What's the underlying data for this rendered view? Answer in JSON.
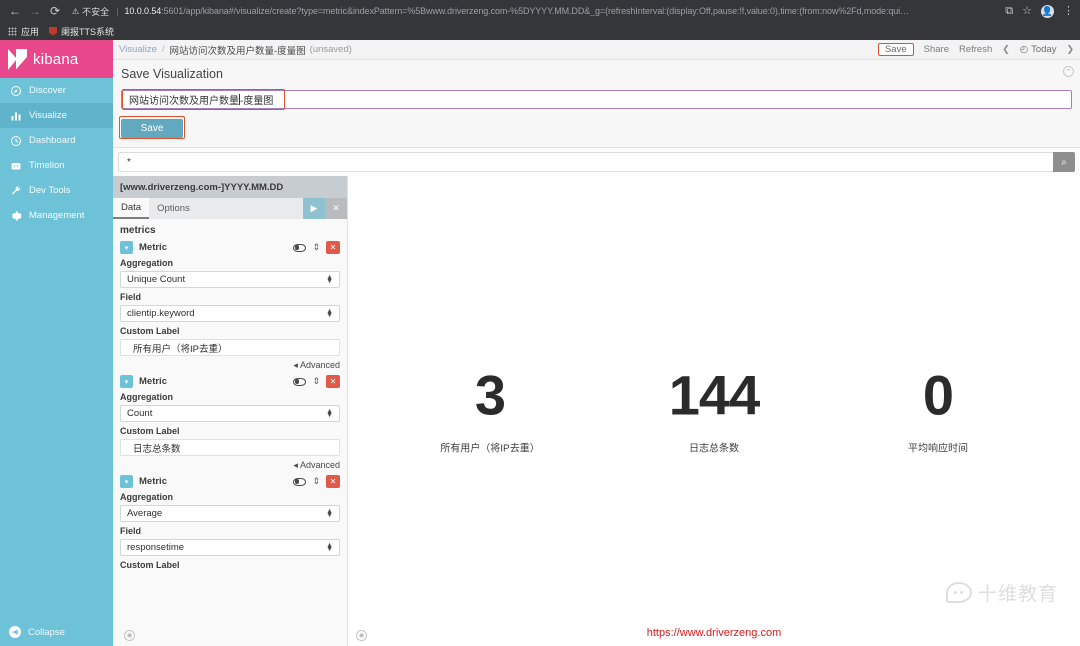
{
  "browser": {
    "back_icon": "←",
    "forward_icon": "→",
    "reload_icon": "⟳",
    "security_label": "不安全",
    "warning_icon": "⚠",
    "url_host": "10.0.0.54",
    "url_rest": ":5601/app/kibana#/visualize/create?type=metric&indexPattern=%5Bwww.driverzeng.com-%5DYYYY.MM.DD&_g=(refreshInterval:(display:Off,pause:!f,value:0),time:(from:now%2Fd,mode:qui…",
    "cast_icon": "⧉",
    "star_icon": "☆",
    "profile_icon": "●",
    "menu_icon": "⋮",
    "bookmarks": [
      {
        "label": "应用",
        "icon": "apps-grid-icon"
      },
      {
        "label": "阑报TTS系统",
        "icon": "bookmark-favicon"
      }
    ]
  },
  "sidebar": {
    "brand": "kibana",
    "items": [
      {
        "label": "Discover",
        "icon": "compass-icon",
        "active": false
      },
      {
        "label": "Visualize",
        "icon": "bar-chart-icon",
        "active": true
      },
      {
        "label": "Dashboard",
        "icon": "dashboard-clock-icon",
        "active": false
      },
      {
        "label": "Timelion",
        "icon": "timelion-icon",
        "active": false
      },
      {
        "label": "Dev Tools",
        "icon": "wrench-icon",
        "active": false
      },
      {
        "label": "Management",
        "icon": "gear-icon",
        "active": false
      }
    ],
    "collapse_label": "Collapse",
    "collapse_icon": "◀"
  },
  "topbar": {
    "breadcrumb_root": "Visualize",
    "breadcrumb_sep": "/",
    "breadcrumb_title": "网站访问次数及用户数量-度量图",
    "unsaved_label": "(unsaved)",
    "save_label": "Save",
    "share_label": "Share",
    "refresh_label": "Refresh",
    "prev_icon": "❮",
    "next_icon": "❯",
    "clock_icon": "◴",
    "time_label": "Today"
  },
  "save_panel": {
    "heading": "Save Visualization",
    "title_value": "网站访问次数及用户数量",
    "title_value_tail": "-度量图",
    "save_button": "Save",
    "collapse_icon": "⌃"
  },
  "query": {
    "value": "*",
    "search_icon": "⌕"
  },
  "editor": {
    "index_pattern": "[www.driverzeng.com-]YYYY.MM.DD",
    "panel_collapse_icon": "❮",
    "tabs": [
      {
        "label": "Data",
        "active": true
      },
      {
        "label": "Options",
        "active": false
      }
    ],
    "apply_icon": "▶",
    "discard_icon": "✕",
    "section_title": "metrics",
    "metric_label": "Metric",
    "toggle_icon": "▾",
    "eye_icon": "eye-icon",
    "grip_icon": "⇕",
    "delete_icon": "✕",
    "aggregation_label": "Aggregation",
    "field_label": "Field",
    "custom_label_label": "Custom Label",
    "advanced_label": "Advanced",
    "advanced_caret": "◂",
    "foot_icon": "◉",
    "metrics": [
      {
        "aggregation": "Unique Count",
        "field": "clientip.keyword",
        "custom_label": "所有用户（将IP去重）",
        "has_field": true
      },
      {
        "aggregation": "Count",
        "field": null,
        "custom_label": "日志总条数",
        "has_field": false
      },
      {
        "aggregation": "Average",
        "field": "responsetime",
        "custom_label": "",
        "has_field": true
      }
    ]
  },
  "visualization": {
    "collapse_icon": "◉",
    "site_url": "https://www.driverzeng.com",
    "watermark_text": "十维教育",
    "metrics": [
      {
        "value": "3",
        "caption": "所有用户（将IP去重）"
      },
      {
        "value": "144",
        "caption": "日志总条数"
      },
      {
        "value": "0",
        "caption": "平均响应时间"
      }
    ]
  },
  "colors": {
    "kibana_pink": "#e8488b",
    "sidebar_teal": "#6ec2d8",
    "highlight_orange": "#e2512e",
    "input_purple": "#a37fc0",
    "save_button_blue": "#62a8bf",
    "delete_red": "#e05a4a",
    "url_red": "#d61c1c"
  }
}
